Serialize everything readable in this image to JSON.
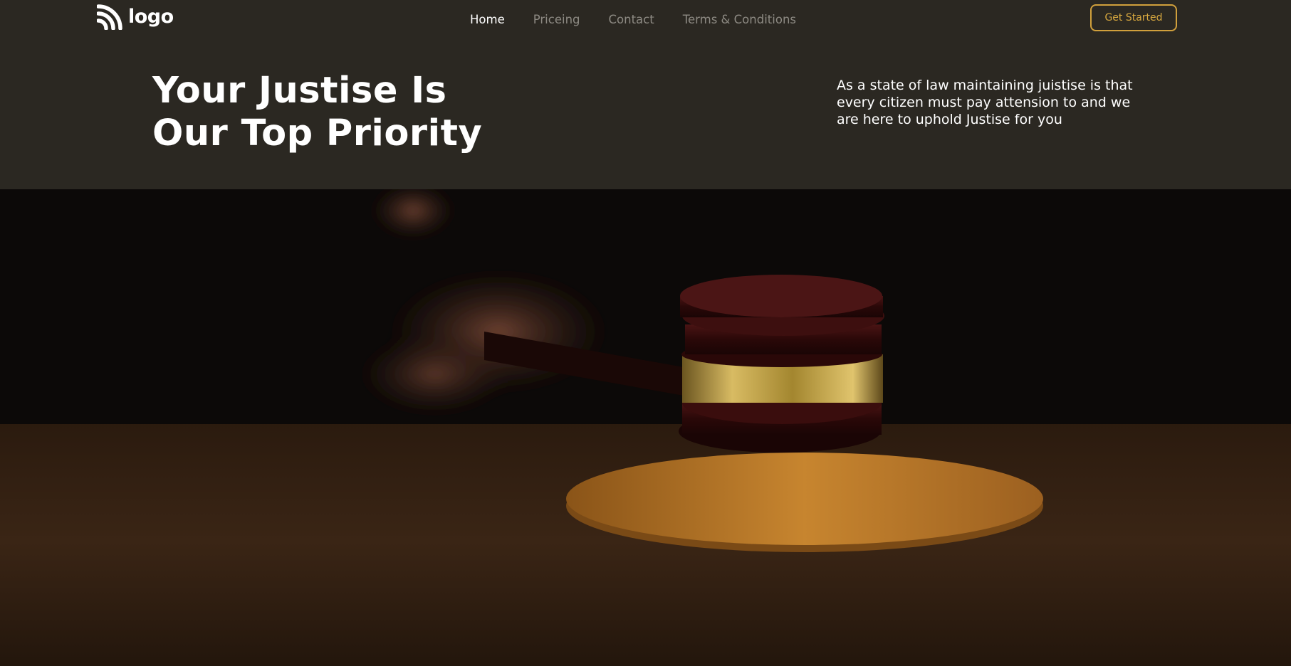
{
  "brand": {
    "logo_text": "logo"
  },
  "nav": {
    "items": [
      {
        "label": "Home",
        "active": true
      },
      {
        "label": "Priceing",
        "active": false
      },
      {
        "label": "Contact",
        "active": false
      },
      {
        "label": "Terms & Conditions",
        "active": false
      }
    ],
    "cta_label": "Get Started"
  },
  "hero": {
    "title_line1": "Your Justise Is",
    "title_line2": "Our Top Priority",
    "description": "As a state of law maintaining juistise is that every citizen must pay attension to and we are here to uphold Justise for you",
    "image_icon": "judge-gavel-photo"
  },
  "colors": {
    "background": "#2b2822",
    "accent": "#d1a03c",
    "nav_inactive": "#8d8a83",
    "text": "#ffffff"
  }
}
